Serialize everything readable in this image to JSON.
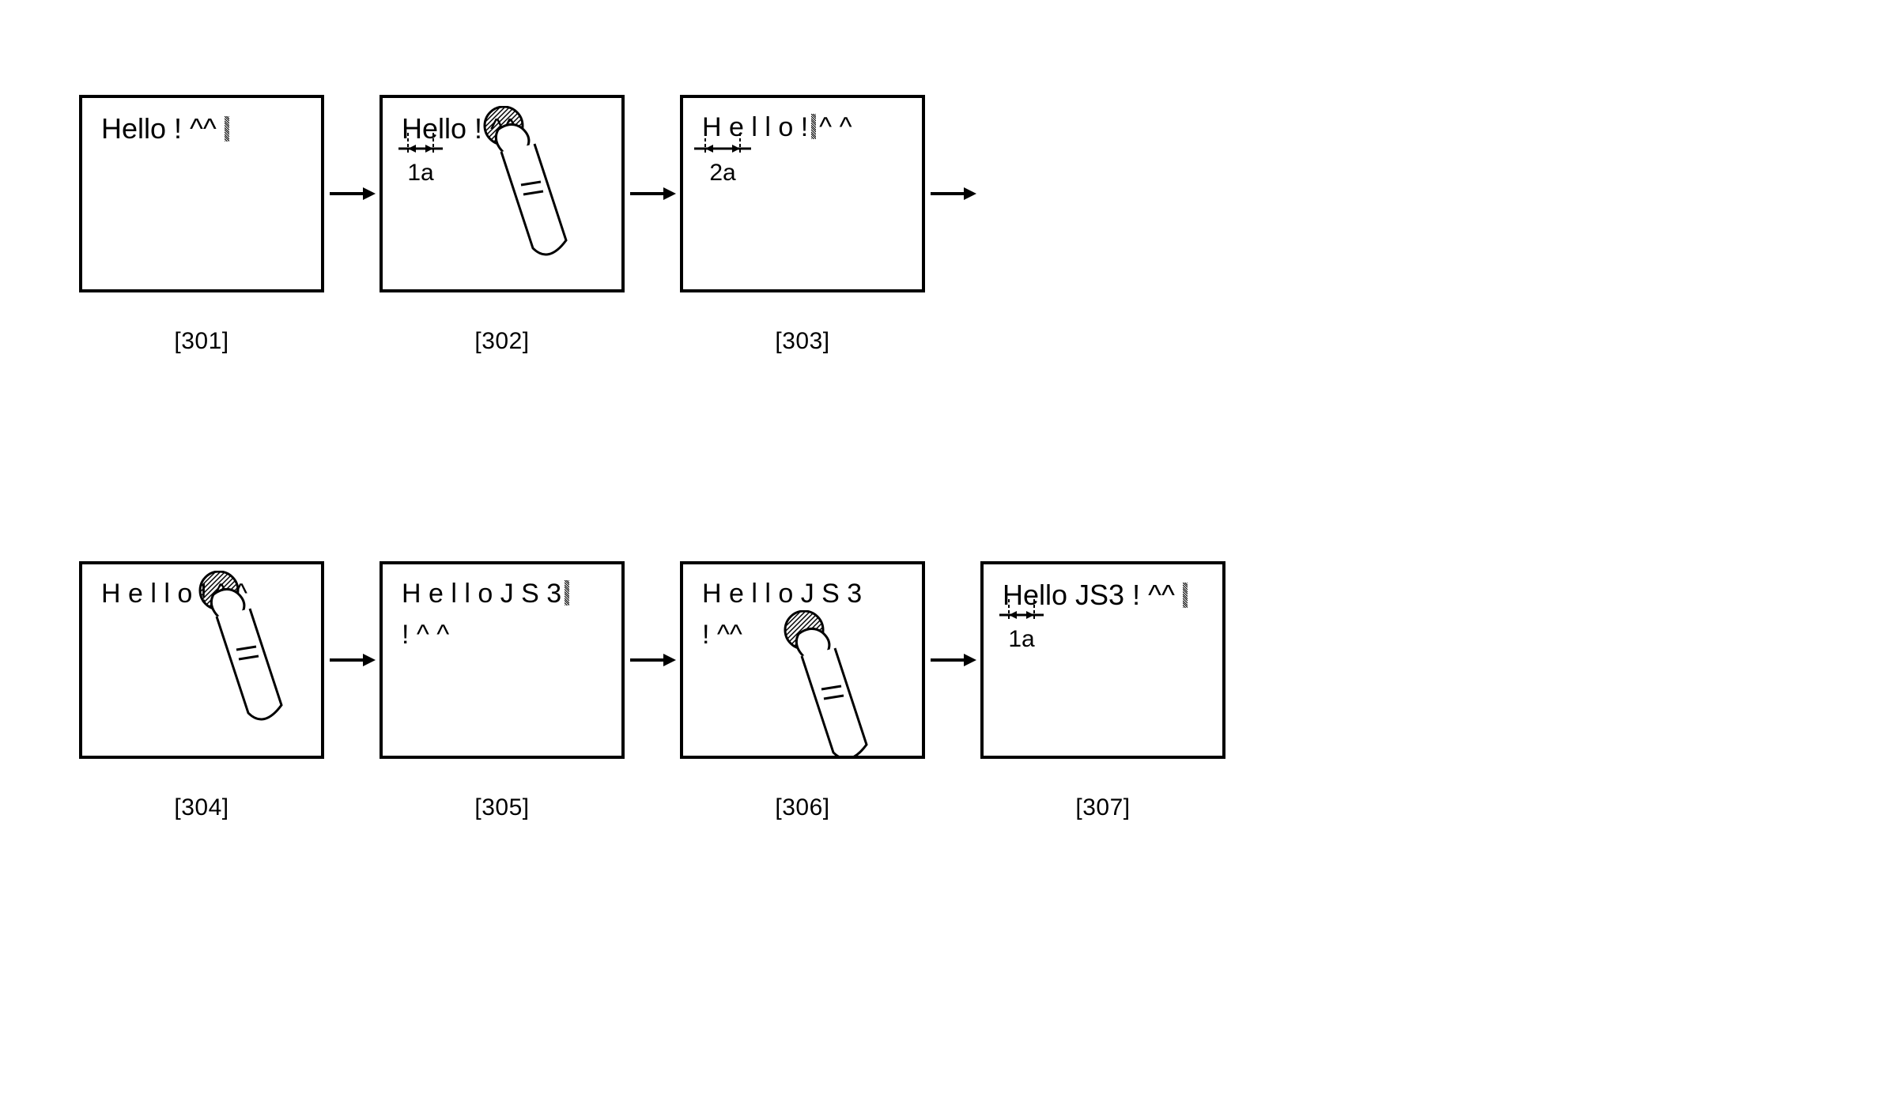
{
  "panels": {
    "p301": {
      "caption": "[301]",
      "text": "Hello ! ^^ "
    },
    "p302": {
      "caption": "[302]",
      "text": "Hello ! ^^",
      "dim_label": "1a"
    },
    "p303": {
      "caption": "[303]",
      "text": "H e l l o ! ^ ^",
      "dim_label": "2a"
    },
    "p304": {
      "caption": "[304]",
      "text": "H e l l o ! ^ ^"
    },
    "p305": {
      "caption": "[305]",
      "line1": "H e l l o J S 3",
      "line2": "! ^ ^"
    },
    "p306": {
      "caption": "[306]",
      "line1": "H e l l o J S 3",
      "line2": "! ^^"
    },
    "p307": {
      "caption": "[307]",
      "text": "Hello JS3 ! ^^ ",
      "dim_label": "1a"
    }
  }
}
